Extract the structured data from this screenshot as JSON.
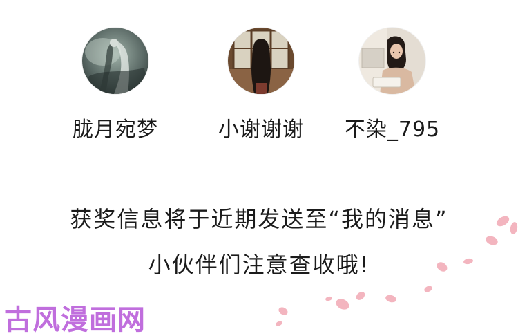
{
  "winners": [
    {
      "name": "胧月宛梦",
      "avatar_icon": "avatar-moonlit-figure"
    },
    {
      "name": "小谢谢谢",
      "avatar_icon": "avatar-girl-by-window"
    },
    {
      "name": "不染_795",
      "avatar_icon": "avatar-girl-at-desk"
    }
  ],
  "notice": {
    "line1": "获奖信息将于近期发送至“我的消息”",
    "line2": "小伙伴们注意查收哦!"
  },
  "watermark": "古风漫画网",
  "colors": {
    "background": "#ffffff",
    "text": "#1c1c1c",
    "petal": "#f2a9b4",
    "watermark": "#b655d8"
  }
}
